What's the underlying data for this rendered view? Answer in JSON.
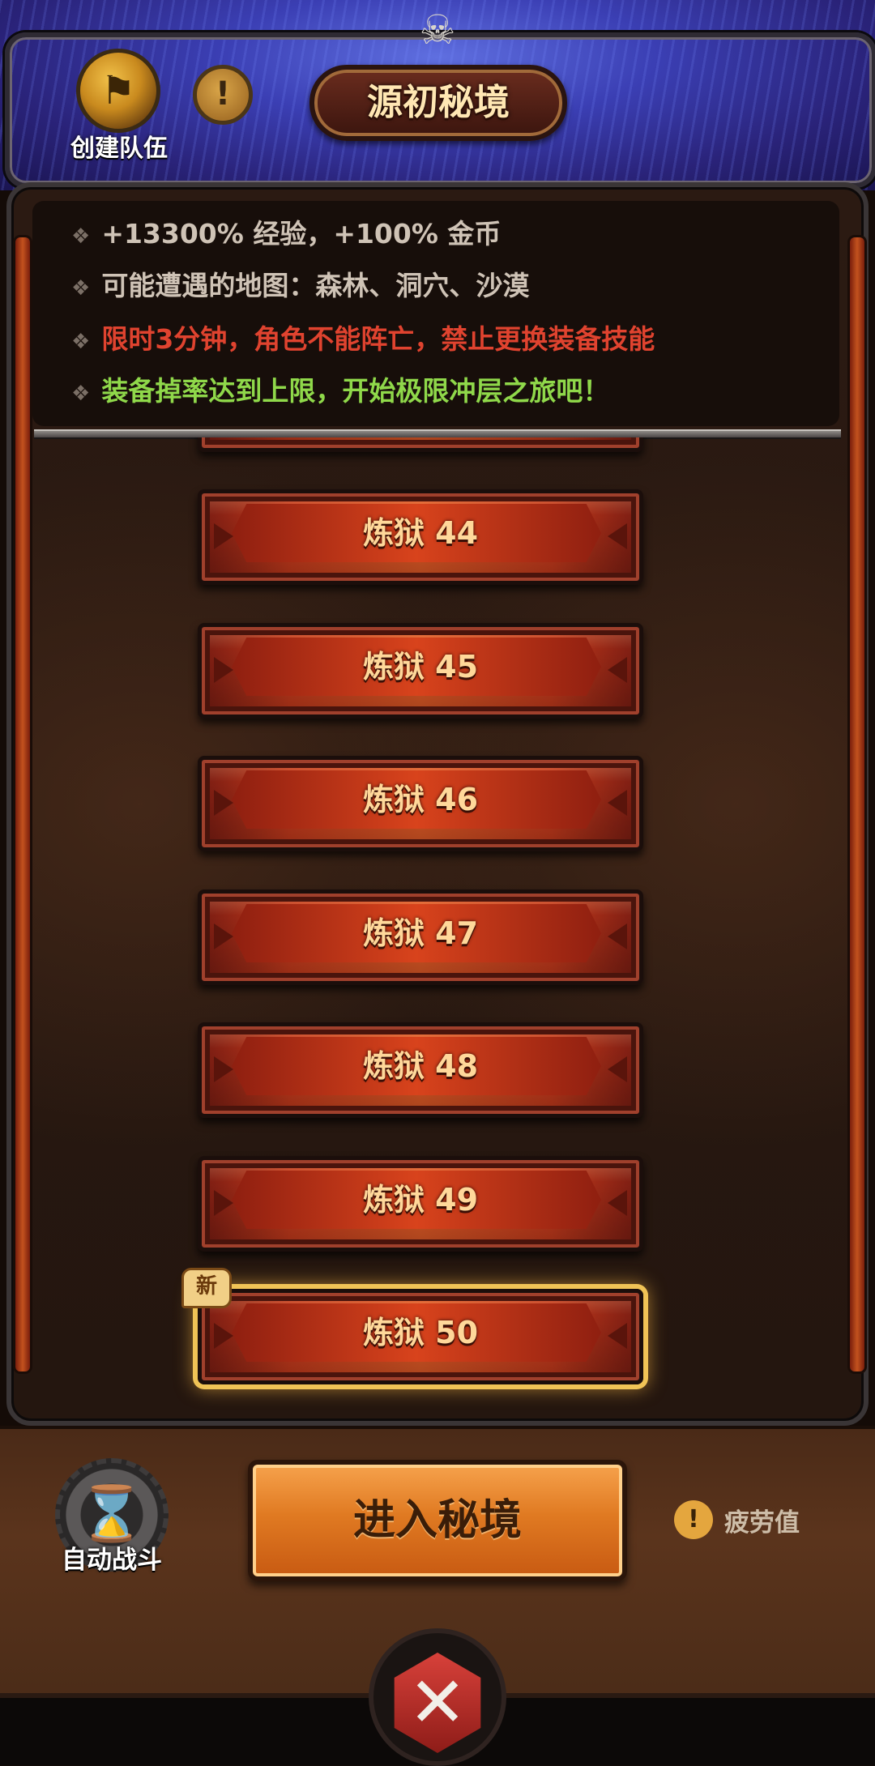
{
  "header": {
    "title": "源初秘境",
    "create_team_label": "创建队伍",
    "info_icon_glyph": "!",
    "team_icon_glyph": "⚑",
    "skull_glyph": "☠"
  },
  "info": {
    "lines": [
      {
        "text": "+13300% 经验，+100% 金币",
        "color": "#cfc3b6"
      },
      {
        "text": "可能遭遇的地图：森林、洞穴、沙漠",
        "color": "#cfc3b6"
      },
      {
        "text": "限时3分钟，角色不能阵亡，禁止更换装备技能",
        "color": "#e0432f"
      },
      {
        "text": "装备掉率达到上限，开始极限冲层之旅吧！",
        "color": "#8fd84a"
      }
    ],
    "bullet": "❖"
  },
  "levels": [
    {
      "label": "炼狱 44"
    },
    {
      "label": "炼狱 45"
    },
    {
      "label": "炼狱 46"
    },
    {
      "label": "炼狱 47"
    },
    {
      "label": "炼狱 48"
    },
    {
      "label": "炼狱 49"
    },
    {
      "label": "炼狱 50",
      "selected": true,
      "badge": "新"
    }
  ],
  "bottom": {
    "auto_battle_label": "自动战斗",
    "enter_label": "进入秘境",
    "fatigue_label": "疲劳值",
    "fatigue_icon_glyph": "!",
    "hourglass_glyph": "⌛",
    "battle_glyph": "✕"
  },
  "colors": {
    "accent_gold": "#f0c356",
    "level_red": "#c43a1c",
    "enter_orange": "#e07a22"
  }
}
